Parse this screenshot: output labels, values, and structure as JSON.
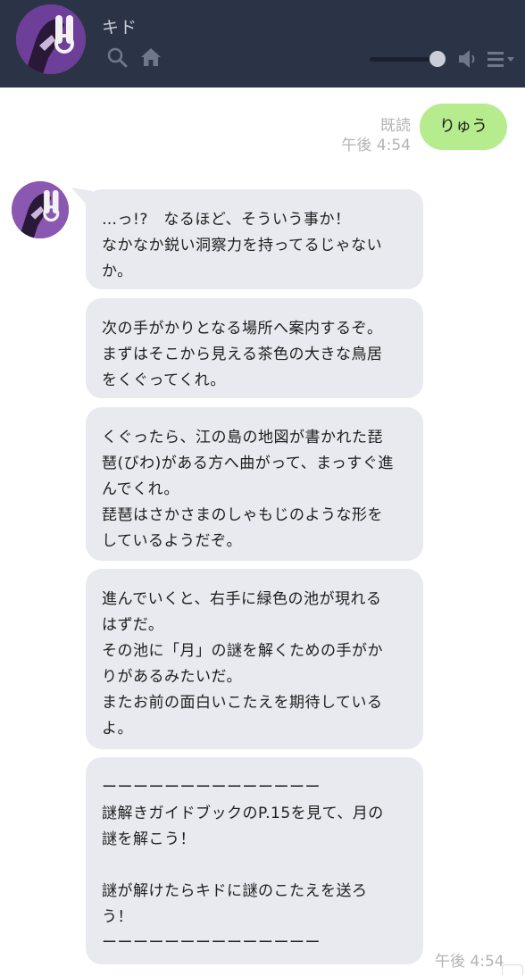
{
  "header": {
    "contact_name": "キド",
    "icons": [
      "search-icon",
      "home-icon",
      "volume-icon",
      "menu-icon"
    ],
    "volume_level": 0.85,
    "background": "#2b3446"
  },
  "outgoing": {
    "text": "りゅう",
    "read_label": "既読",
    "time": "午後 4:54",
    "bubble_color": "#b6ec8e"
  },
  "incoming": {
    "sender": "キド",
    "bubble_color": "#e8eaef",
    "messages": [
      "…っ!?　なるほど、そういう事か！\nなかなか鋭い洞察力を持ってるじゃない\nか。",
      "次の手がかりとなる場所へ案内するぞ。\nまずはそこから見える茶色の大きな鳥居\nをくぐってくれ。",
      "くぐったら、江の島の地図が書かれた琵\n琶(びわ)がある方へ曲がって、まっすぐ進\nんでくれ。\n琵琶はさかさまのしゃもじのような形を\nしているようだぞ。",
      "進んでいくと、右手に緑色の池が現れる\nはずだ。\nその池に「月」の謎を解くための手がか\nりがあるみたいだ。\nまたお前の面白いこたえを期待している\nよ。",
      "ーーーーーーーーーーーーーー\n謎解きガイドブックのP.15を見て、月の\n謎を解こう！\n\n謎が解けたらキドに謎のこたえを送ろ\nう！\nーーーーーーーーーーーーーー"
    ],
    "time": "午後 4:54"
  }
}
